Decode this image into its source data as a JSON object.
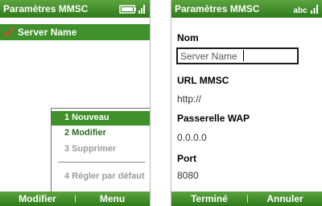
{
  "screen_list": {
    "title": "Paramètres MMSC",
    "selected_item": "Server Name",
    "menu": {
      "items": [
        {
          "label": "1 Nouveau",
          "state": "selected"
        },
        {
          "label": "2 Modifier",
          "state": "enabled"
        },
        {
          "label": "3 Supprimer",
          "state": "disabled"
        },
        {
          "label": "4 Régler par défaut",
          "state": "disabled"
        }
      ]
    },
    "softkeys": {
      "left": "Modifier",
      "right": "Menu"
    }
  },
  "screen_edit": {
    "title": "Paramètres MMSC",
    "input_mode": "abc",
    "fields": {
      "nom": {
        "label": "Nom",
        "value": "Server Name"
      },
      "url": {
        "label": "URL MMSC",
        "value": "http://"
      },
      "wap": {
        "label": "Passerelle WAP",
        "value": "0.0.0.0"
      },
      "port": {
        "label": "Port",
        "value": "8080"
      }
    },
    "softkeys": {
      "left": "Terminé",
      "right": "Annuler"
    }
  },
  "colors": {
    "accent": "#3f8f2a",
    "titlebar_top": "#5ca43f",
    "titlebar_bottom": "#2f7a1c",
    "check_red": "#c0392b"
  },
  "icons": [
    "battery-icon",
    "signal-icon",
    "checkmark-icon"
  ]
}
